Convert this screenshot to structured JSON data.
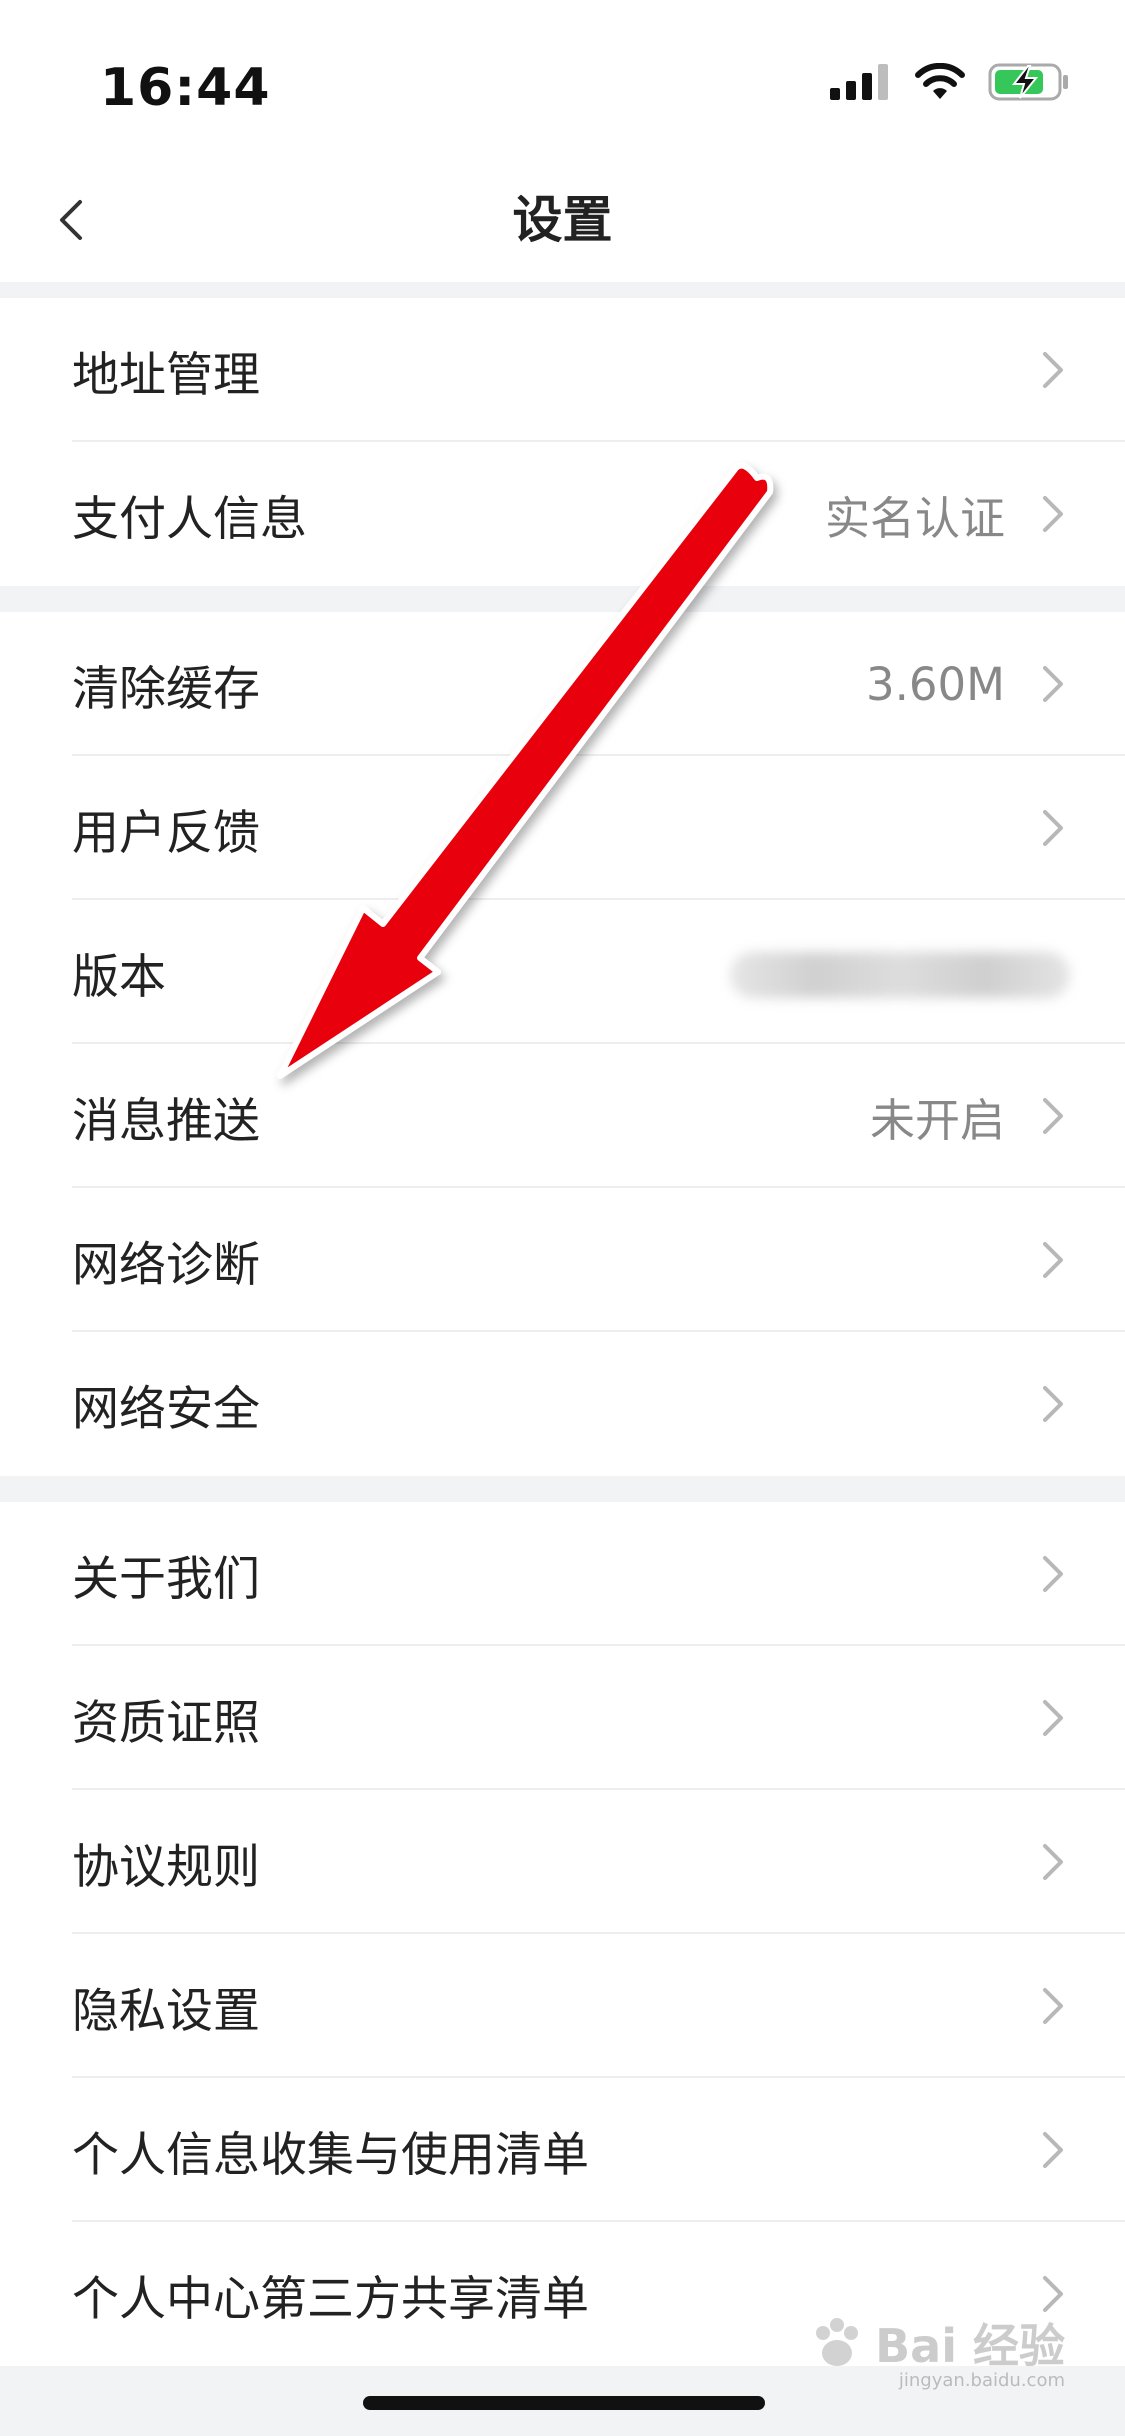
{
  "status_bar": {
    "time": "16:44",
    "icons": [
      "signal-icon",
      "wifi-icon",
      "battery-charging-icon"
    ]
  },
  "nav": {
    "title": "设置",
    "back_icon": "chevron-left-icon"
  },
  "groups": [
    {
      "items": [
        {
          "label": "地址管理",
          "value": ""
        },
        {
          "label": "支付人信息",
          "value": "实名认证"
        }
      ]
    },
    {
      "items": [
        {
          "label": "清除缓存",
          "value": "3.60M"
        },
        {
          "label": "用户反馈",
          "value": ""
        },
        {
          "label": "版本",
          "value": ""
        },
        {
          "label": "消息推送",
          "value": "未开启"
        },
        {
          "label": "网络诊断",
          "value": ""
        },
        {
          "label": "网络安全",
          "value": ""
        }
      ]
    },
    {
      "items": [
        {
          "label": "关于我们",
          "value": ""
        },
        {
          "label": "资质证照",
          "value": ""
        },
        {
          "label": "协议规则",
          "value": ""
        },
        {
          "label": "隐私设置",
          "value": ""
        },
        {
          "label": "个人信息收集与使用清单",
          "value": ""
        },
        {
          "label": "个人中心第三方共享清单",
          "value": ""
        }
      ]
    }
  ],
  "overlay": {
    "arrow_color": "#e8000b",
    "watermark_text": "Bai  经验",
    "watermark_sub": "jingyan.baidu.com"
  },
  "colors": {
    "section_gap": "#f2f3f5",
    "value_text": "#888888",
    "chevron": "#b8b8b8"
  }
}
